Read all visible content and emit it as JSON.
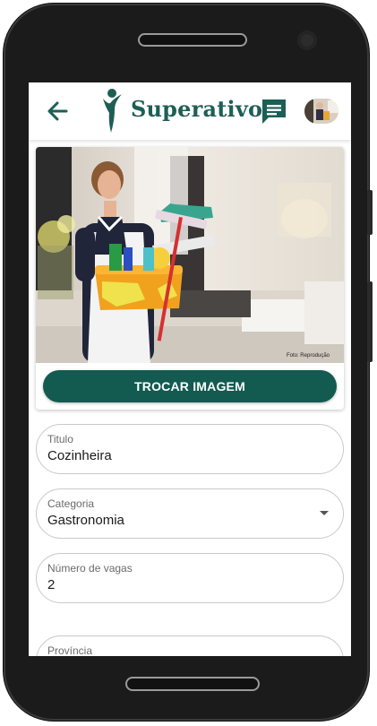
{
  "app": {
    "brand_name": "Superativo",
    "brand_color": "#1e5f55"
  },
  "header": {
    "back_icon": "arrow-left-icon",
    "chat_icon": "message-square-icon",
    "avatar_icon": "user-avatar"
  },
  "image_card": {
    "credit": "Foto: Reprodução",
    "change_button_label": "TROCAR IMAGEM"
  },
  "form": {
    "titulo": {
      "label": "Titulo",
      "value": "Cozinheira"
    },
    "categoria": {
      "label": "Categoria",
      "value": "Gastronomia"
    },
    "vagas": {
      "label": "Número de vagas",
      "value": "2"
    },
    "provincia": {
      "label": "Província",
      "value": ""
    }
  },
  "colors": {
    "primary": "#135a50",
    "field_border": "#c9c9c9"
  }
}
